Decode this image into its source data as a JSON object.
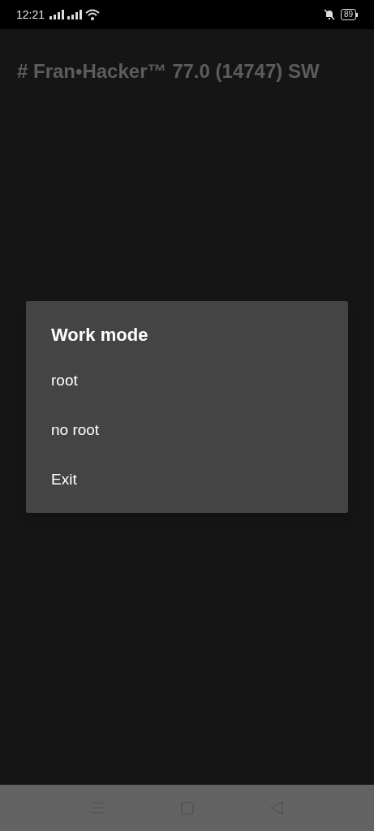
{
  "status_bar": {
    "time": "12:21",
    "battery": "89"
  },
  "app": {
    "title": "# Fran•Hacker™ 77.0 (14747) SW"
  },
  "dialog": {
    "title": "Work mode",
    "options": [
      "root",
      "no root",
      "Exit"
    ]
  }
}
